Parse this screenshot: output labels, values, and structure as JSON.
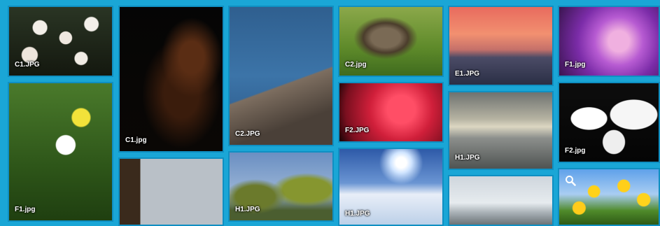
{
  "gallery": {
    "tiles": [
      {
        "caption": "C1.JPG"
      },
      {
        "caption": "C1.jpg"
      },
      {
        "caption": "C2.JPG"
      },
      {
        "caption": "C2.jpg"
      },
      {
        "caption": "E1.JPG"
      },
      {
        "caption": "F1.jpg"
      },
      {
        "caption": "F1.jpg"
      },
      {
        "caption": "F2.JPG"
      },
      {
        "caption": "H1.JPG"
      },
      {
        "caption": "F2.jpg"
      },
      {
        "caption": ""
      },
      {
        "caption": "H1.JPG"
      },
      {
        "caption": "H1.JPG"
      },
      {
        "caption": ""
      },
      {
        "caption": ""
      }
    ],
    "accent_color": "#1aa6d6",
    "zoom_icon": "search-icon"
  }
}
